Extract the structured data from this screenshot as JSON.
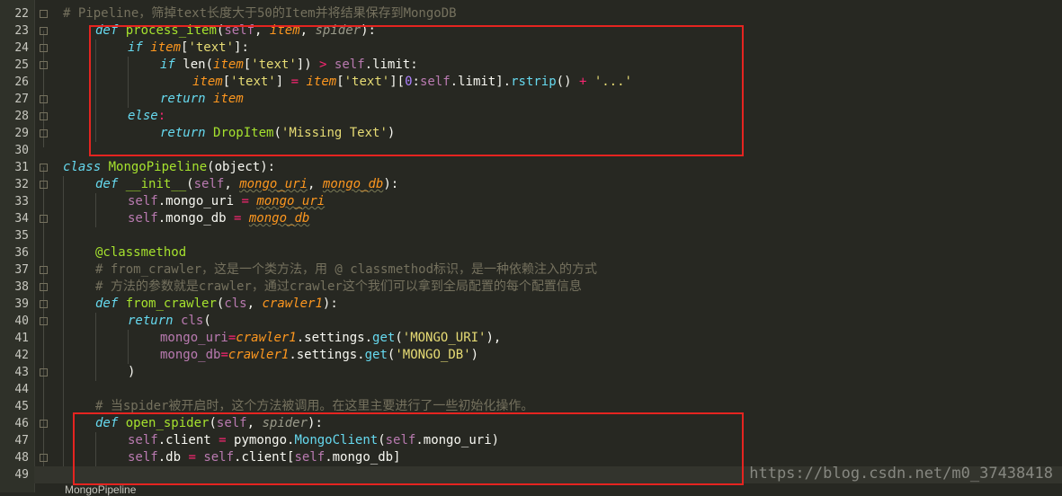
{
  "editor": {
    "line_numbers": [
      "22",
      "23",
      "24",
      "25",
      "26",
      "27",
      "28",
      "29",
      "30",
      "31",
      "32",
      "33",
      "34",
      "35",
      "36",
      "37",
      "38",
      "39",
      "40",
      "41",
      "42",
      "43",
      "44",
      "45",
      "46",
      "47",
      "48",
      "49"
    ],
    "structure_label": "MongoPipeline",
    "watermark": "https://blog.csdn.net/m0_37438418",
    "highlight_color": "#e52420"
  },
  "code": {
    "l22": "# Pipeline，筛掉text长度大于50的Item并将结果保存到MongoDB",
    "l23": {
      "def": "def",
      "name": "process_item",
      "p1": "(",
      "self": "self",
      "c1": ", ",
      "a1": "item",
      "c2": ", ",
      "a2": "spider",
      "p2": "):"
    },
    "l24": {
      "kw": "if",
      "sp": " ",
      "v": "item",
      "b1": "[",
      "s": "'text'",
      "b2": "]:"
    },
    "l25": {
      "kw": "if",
      "sp": " ",
      "fn": "len",
      "p1": "(",
      "v": "item",
      "b1": "[",
      "s": "'text'",
      "b2": "])",
      "op": " > ",
      "self": "self",
      "rest": ".limit:"
    },
    "l26": {
      "v": "item",
      "b1": "[",
      "s1": "'text'",
      "b2": "]",
      "op1": " = ",
      "v2": "item",
      "b3": "[",
      "s2": "'text'",
      "b4": "][",
      "n": "0",
      "c": ":",
      "self": "self",
      "rest": ".limit].",
      "m": "rstrip",
      "p": "()",
      "op2": " + ",
      "s3": "'...'"
    },
    "l27": {
      "kw": "return",
      "sp": " ",
      "v": "item"
    },
    "l28": {
      "kw": "else",
      "c": ":"
    },
    "l29": {
      "kw": "return",
      "sp": " ",
      "cls": "DropItem",
      "p1": "(",
      "s": "'Missing Text'",
      "p2": ")"
    },
    "l31": {
      "kw": "class",
      "sp": " ",
      "name": "MongoPipeline",
      "p1": "(",
      "base": "object",
      "p2": "):"
    },
    "l32": {
      "def": "def",
      "sp": " ",
      "name": "__init__",
      "p1": "(",
      "self": "self",
      "c1": ", ",
      "a1": "mongo_uri",
      "c2": ", ",
      "a2": "mongo_db",
      "p2": "):"
    },
    "l33": {
      "self": "self",
      "attr": ".mongo_uri",
      "op": " = ",
      "v": "mongo_uri"
    },
    "l34": {
      "self": "self",
      "attr": ".mongo_db",
      "op": " = ",
      "v": "mongo_db"
    },
    "l36": "@classmethod",
    "l37": "# from_crawler，这是一个类方法，用 @ classmethod标识，是一种依赖注入的方式",
    "l38": "# 方法的参数就是crawler，通过crawler这个我们可以拿到全局配置的每个配置信息",
    "l39": {
      "def": "def",
      "sp": " ",
      "name": "from_crawler",
      "p1": "(",
      "cls": "cls",
      "c1": ", ",
      "a1": "crawler1",
      "p2": "):"
    },
    "l40": {
      "kw": "return",
      "sp": " ",
      "cls": "cls",
      "p": "("
    },
    "l41": {
      "kwarg": "mongo_uri",
      "eq": "=",
      "v": "crawler1",
      "mid": ".settings.",
      "m": "get",
      "p1": "(",
      "s": "'MONGO_URI'",
      "p2": "),"
    },
    "l42": {
      "kwarg": "mongo_db",
      "eq": "=",
      "v": "crawler1",
      "mid": ".settings.",
      "m": "get",
      "p1": "(",
      "s": "'MONGO_DB'",
      "p2": ")"
    },
    "l43": ")",
    "l45": "# 当spider被开启时，这个方法被调用。在这里主要进行了一些初始化操作。",
    "l46": {
      "def": "def",
      "sp": " ",
      "name": "open_spider",
      "p1": "(",
      "self": "self",
      "c1": ", ",
      "a1": "spider",
      "p2": "):"
    },
    "l47": {
      "self": "self",
      "attr": ".client",
      "op": " = ",
      "mod": "pymongo.",
      "cls": "MongoClient",
      "p1": "(",
      "self2": "self",
      "rest": ".mongo_uri)"
    },
    "l48": {
      "self": "self",
      "attr": ".db",
      "op": " = ",
      "self2": "self",
      "mid": ".client[",
      "self3": "self",
      "rest": ".mongo_db]"
    }
  }
}
